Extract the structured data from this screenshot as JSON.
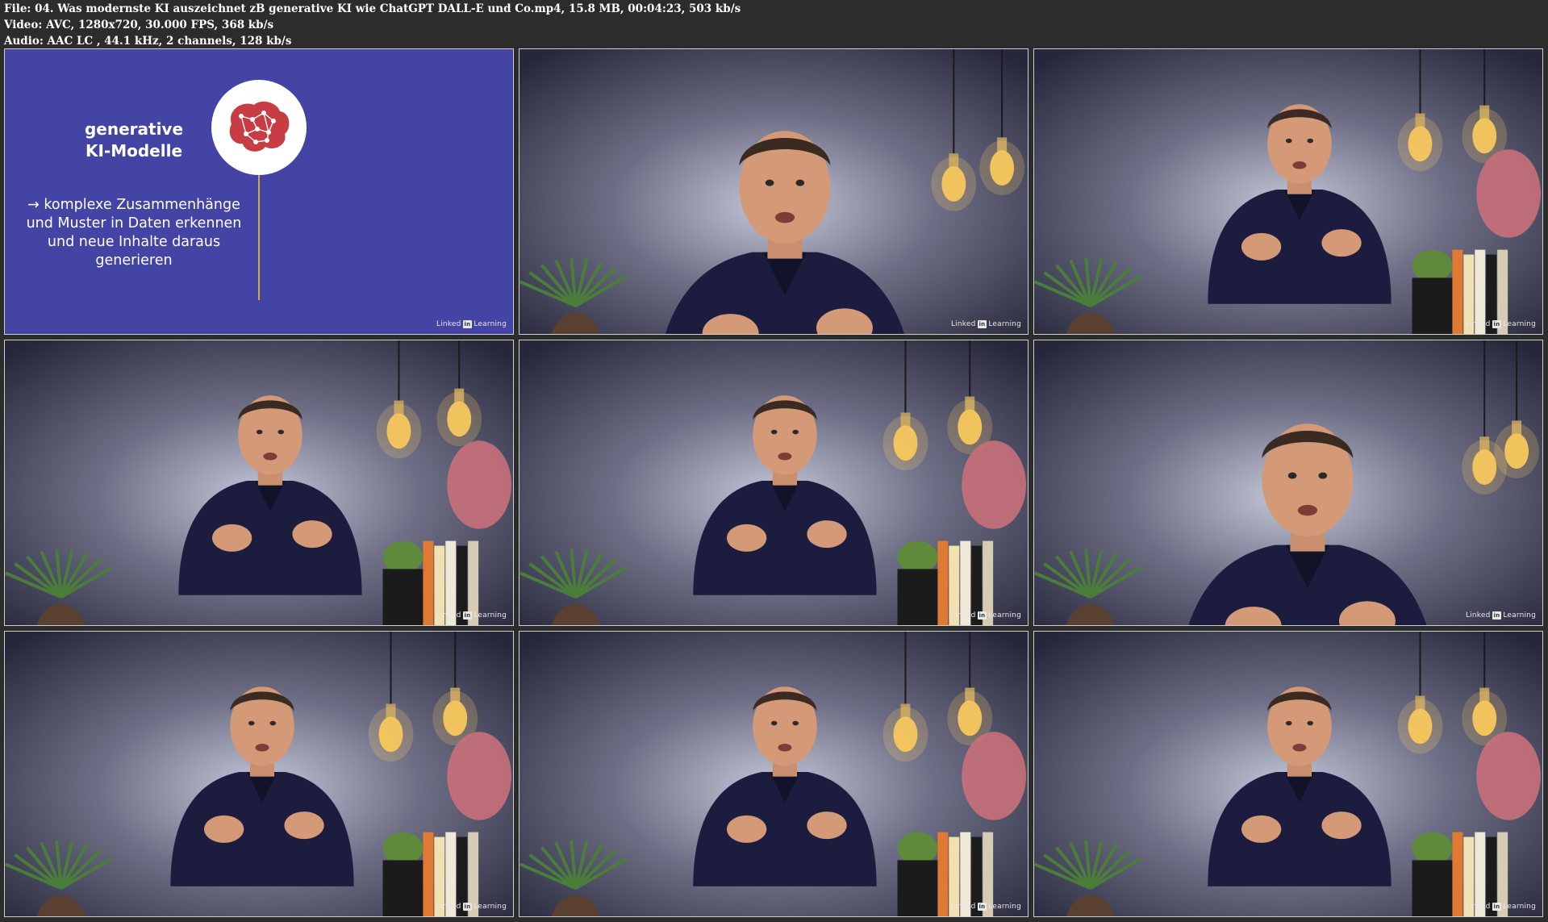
{
  "meta": {
    "file_line": "File: 04. Was modernste KI auszeichnet zB generative KI wie ChatGPT DALL-E und Co.mp4, 15.8 MB, 00:04:23, 503 kb/s",
    "video_line": "Video: AVC, 1280x720, 30.000 FPS, 368 kb/s",
    "audio_line": "Audio: AAC LC , 44.1 kHz, 2 channels, 128 kb/s"
  },
  "slide": {
    "title_line1": "generative",
    "title_line2": "KI-Modelle",
    "body_line1": "→ komplexe Zusammenhänge",
    "body_line2": "und Muster in Daten erkennen",
    "body_line3": "und neue Inhalte daraus",
    "body_line4": "generieren",
    "icon": "brain-network-icon",
    "background": "#4444a4",
    "accent": "#d8a24a"
  },
  "watermark": {
    "prefix": "Linked",
    "in": "in",
    "suffix": "Learning"
  },
  "thumbnails": [
    {
      "content": "slide"
    },
    {
      "content": "presenter-closeup"
    },
    {
      "content": "presenter-wide"
    },
    {
      "content": "presenter-medium"
    },
    {
      "content": "presenter-medium"
    },
    {
      "content": "presenter-closeup"
    },
    {
      "content": "presenter-medium"
    },
    {
      "content": "presenter-medium"
    },
    {
      "content": "presenter-wide"
    }
  ]
}
